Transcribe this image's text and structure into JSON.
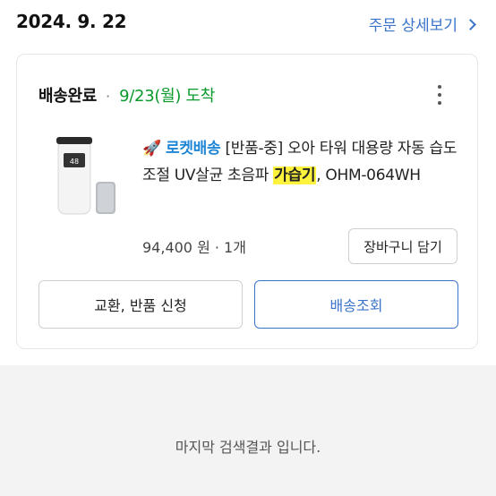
{
  "order": {
    "date": "2024. 9. 22",
    "detail_link": "주문 상세보기"
  },
  "shipment": {
    "status": "배송완료",
    "separator": "·",
    "arrival": "9/23(월) 도착"
  },
  "product": {
    "badge": "로켓배송",
    "title_before": " [반품-중] 오아 타워 대용량 자동 습도조절 UV살균 초음파 ",
    "title_highlight": "가습기",
    "title_after": ", OHM-064WH",
    "price_qty": "94,400 원 · 1개",
    "cart_button": "장바구니 담기"
  },
  "actions": {
    "exchange": "교환, 반품 신청",
    "track": "배송조회"
  },
  "footer": {
    "end_message": "마지막 검색결과 입니다."
  },
  "colors": {
    "link_blue": "#3a73c9",
    "arrival_green": "#0a9a2c",
    "highlight_yellow": "#fff23d",
    "rocket_blue": "#1f86d6"
  }
}
